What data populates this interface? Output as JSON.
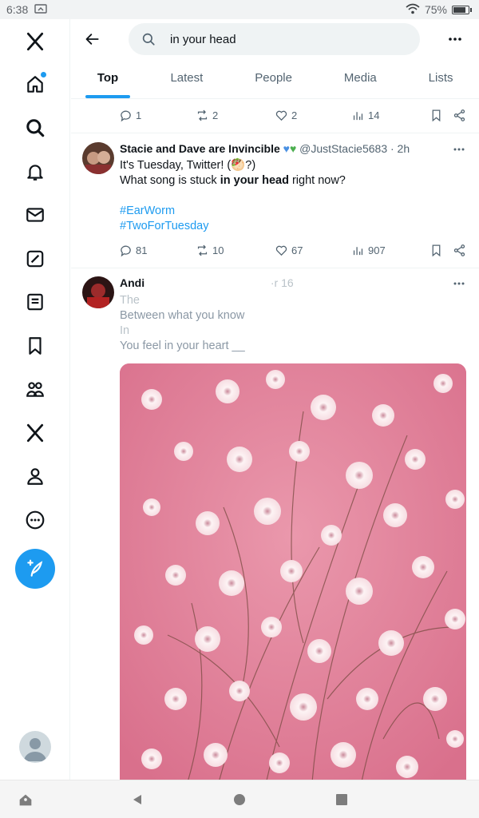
{
  "status": {
    "time": "6:38",
    "battery": "75%"
  },
  "search": {
    "query": "in your head"
  },
  "tabs": [
    {
      "label": "Top"
    },
    {
      "label": "Latest"
    },
    {
      "label": "People"
    },
    {
      "label": "Media"
    },
    {
      "label": "Lists"
    }
  ],
  "first_tweet_actions": {
    "replies": "1",
    "reposts": "2",
    "likes": "2",
    "views": "14"
  },
  "tweet1": {
    "name": "Stacie and Dave are Invincible",
    "handle": "@JustStacie5683 · 2h",
    "line1": "It's Tuesday, Twitter!  (🥙?)",
    "line2_pre": "What song is stuck ",
    "line2_bold": "in your head",
    "line2_post": " right now?",
    "hashtag1": "#EarWorm",
    "hashtag2": "#TwoForTuesday",
    "replies": "81",
    "reposts": "10",
    "likes": "67",
    "views": "907"
  },
  "tweet2": {
    "name_fragment": "Andi",
    "time_fragment": "·r 16",
    "line1": "The",
    "line2": "Between what you know",
    "line3": "In",
    "line4": "You feel in your heart __"
  },
  "colors": {
    "accent": "#1d9bf0",
    "text": "#0f1419",
    "muted": "#536471",
    "media_pink": "#e3889f"
  }
}
